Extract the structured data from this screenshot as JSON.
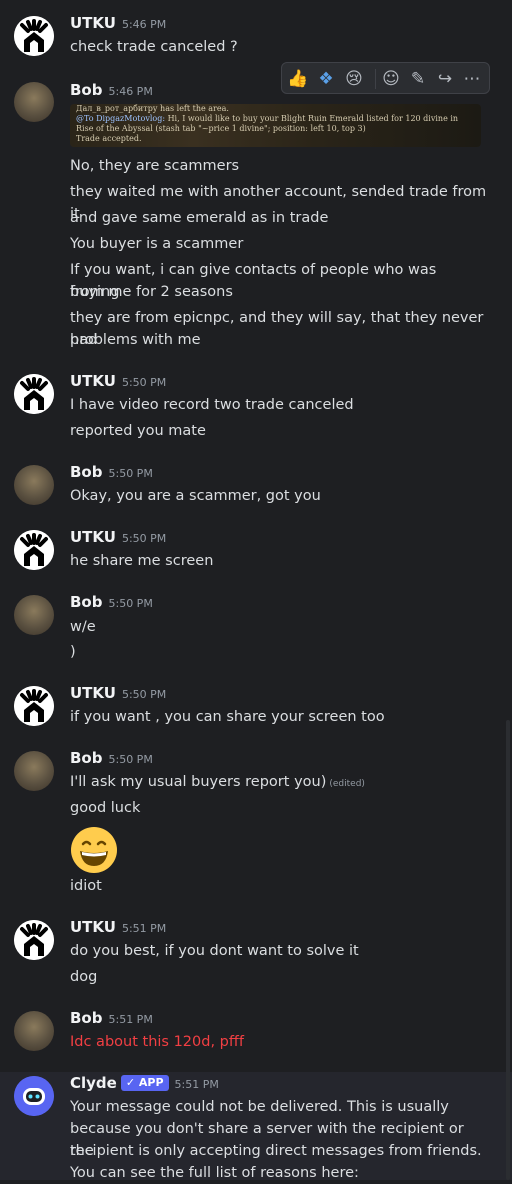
{
  "colors": {
    "bg": "#1e1f22",
    "accent": "#5865f2",
    "danger": "#f23f43"
  },
  "toolbar": {
    "icons": [
      "thumbs-up-icon",
      "diamond-icon",
      "crying-face-icon",
      "add-reaction-icon",
      "edit-icon",
      "reply-icon",
      "more-icon"
    ],
    "glyphs": [
      "👍",
      "❖",
      "😢",
      "☺",
      "✎",
      "↪",
      "⋯"
    ]
  },
  "embed": {
    "line1": "Дал_в_рот_арбитру has left the area.",
    "line2_to": "@To DipgazMotovlog:",
    "line2_rest": " Hi, I would like to buy your Blight Ruin Emerald listed for 120 divine in",
    "line3": "Rise of the Abyssal (stash tab \"~price 1 divine\"; position: left 10, top 3)",
    "line4": "Trade accepted."
  },
  "messages": [
    {
      "author": "UTKU",
      "time": "5:46 PM",
      "lines": [
        "check trade canceled ?"
      ]
    },
    {
      "author": "Bob",
      "time": "5:46 PM",
      "lines": [
        "No, they are scammers",
        "they waited me with another account, sended trade from it",
        "and gave same emerald as in trade",
        "You buyer is a scammer",
        "If you want, i can give contacts of people who was buying",
        "from me for 2 seasons",
        "they are from epicnpc, and they will say, that they never had",
        "problems with me"
      ]
    },
    {
      "author": "UTKU",
      "time": "5:50 PM",
      "lines": [
        "I have video record two trade canceled",
        "reported you mate"
      ]
    },
    {
      "author": "Bob",
      "time": "5:50 PM",
      "lines": [
        "Okay, you are a scammer, got you"
      ]
    },
    {
      "author": "UTKU",
      "time": "5:50 PM",
      "lines": [
        "he share me screen"
      ]
    },
    {
      "author": "Bob",
      "time": "5:50 PM",
      "lines": [
        "w/e",
        ")"
      ]
    },
    {
      "author": "UTKU",
      "time": "5:50 PM",
      "lines": [
        "if you want , you can share your screen too"
      ]
    },
    {
      "author": "Bob",
      "time": "5:50 PM",
      "lines": [
        "I'll ask my usual buyers report you)",
        "good luck",
        "idiot"
      ],
      "edited": "(edited)",
      "emoji": "grinning-face-icon"
    },
    {
      "author": "UTKU",
      "time": "5:51 PM",
      "lines": [
        "do you best, if you dont want to solve it",
        "dog"
      ]
    },
    {
      "author": "Bob",
      "time": "5:51 PM",
      "lines": [
        "Idc about this 120d, pfff"
      ]
    },
    {
      "author": "Clyde",
      "time": "5:51 PM",
      "badge": "APP",
      "lines": [
        "Your message could not be delivered. This is usually",
        "because you don't share a server with the recipient or the",
        "recipient is only accepting direct messages from friends.",
        "You can see the full list of reasons here:"
      ]
    }
  ]
}
